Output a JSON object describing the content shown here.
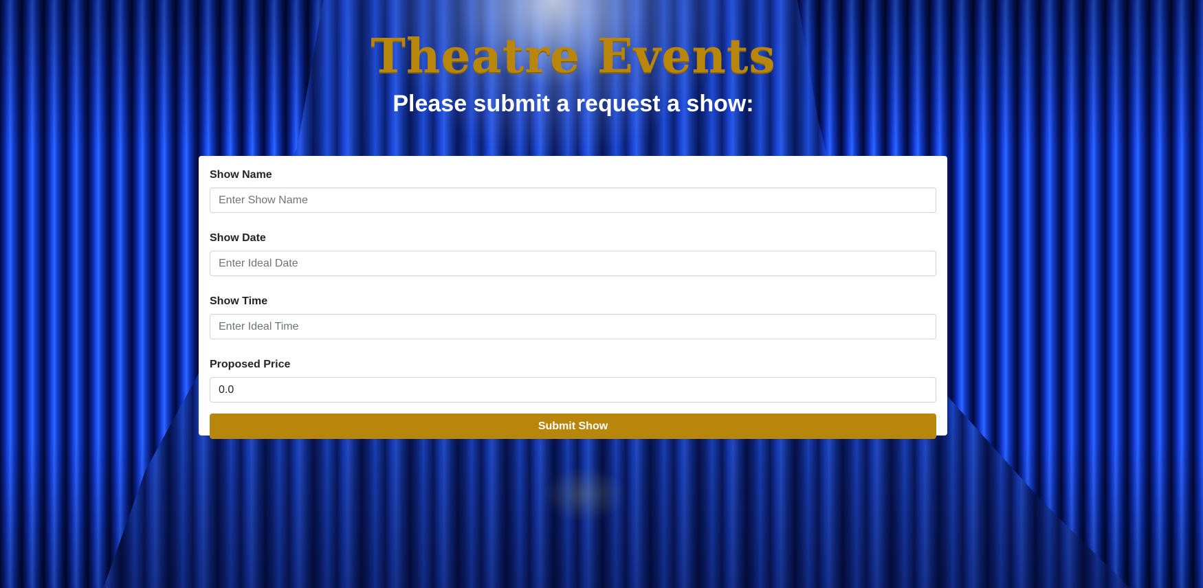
{
  "header": {
    "brand": "Theatre Events",
    "subtitle": "Please submit a request a show:"
  },
  "form": {
    "fields": [
      {
        "label": "Show Name",
        "placeholder": "Enter Show Name",
        "value": ""
      },
      {
        "label": "Show Date",
        "placeholder": "Enter Ideal Date",
        "value": ""
      },
      {
        "label": "Show Time",
        "placeholder": "Enter Ideal Time",
        "value": ""
      },
      {
        "label": "Proposed Price",
        "placeholder": "",
        "value": "0.0"
      }
    ],
    "submit_label": "Submit Show"
  },
  "colors": {
    "accent": "#b8860b",
    "curtain": "#1a46d8",
    "card": "#ffffff"
  }
}
